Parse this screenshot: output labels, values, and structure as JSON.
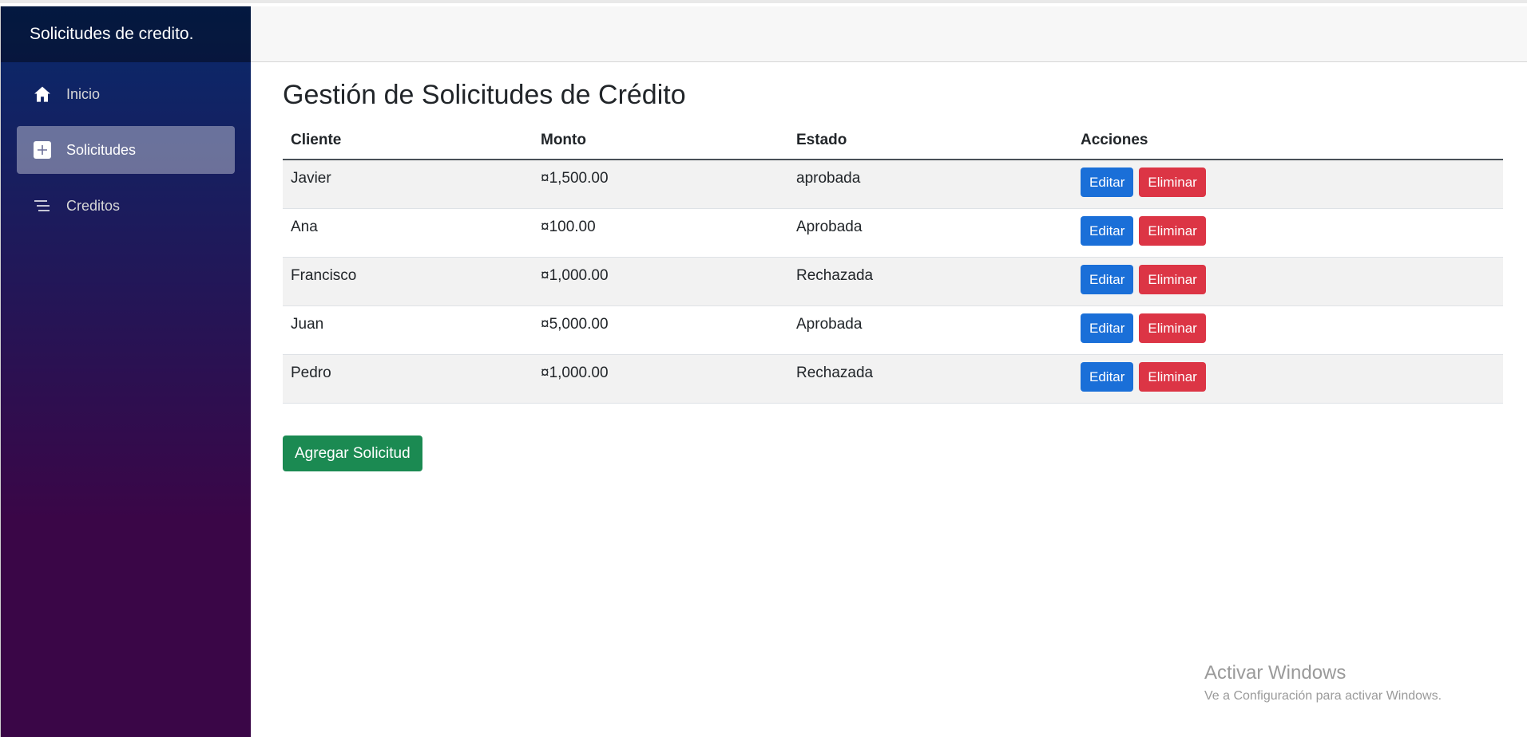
{
  "sidebar": {
    "brand": "Solicitudes de credito.",
    "items": [
      {
        "label": "Inicio",
        "icon": "home-icon",
        "active": false
      },
      {
        "label": "Solicitudes",
        "icon": "plus-square-icon",
        "active": true
      },
      {
        "label": "Creditos",
        "icon": "list-icon",
        "active": false
      }
    ]
  },
  "main": {
    "title": "Gestión de Solicitudes de Crédito",
    "table": {
      "headers": [
        "Cliente",
        "Monto",
        "Estado",
        "Acciones"
      ],
      "rows": [
        {
          "cliente": "Javier",
          "monto": "¤1,500.00",
          "estado": "aprobada"
        },
        {
          "cliente": "Ana",
          "monto": "¤100.00",
          "estado": "Aprobada"
        },
        {
          "cliente": "Francisco",
          "monto": "¤1,000.00",
          "estado": "Rechazada"
        },
        {
          "cliente": "Juan",
          "monto": "¤5,000.00",
          "estado": "Aprobada"
        },
        {
          "cliente": "Pedro",
          "monto": "¤1,000.00",
          "estado": "Rechazada"
        }
      ],
      "edit_label": "Editar",
      "delete_label": "Eliminar"
    },
    "add_button": "Agregar Solicitud"
  },
  "watermark": {
    "title": "Activar Windows",
    "subtitle": "Ve a Configuración para activar Windows."
  },
  "colors": {
    "sidebar_top": "#072a6b",
    "sidebar_bottom": "#3a0647",
    "edit": "#1a6fd8",
    "delete": "#dc3545",
    "add": "#1b8a52"
  }
}
